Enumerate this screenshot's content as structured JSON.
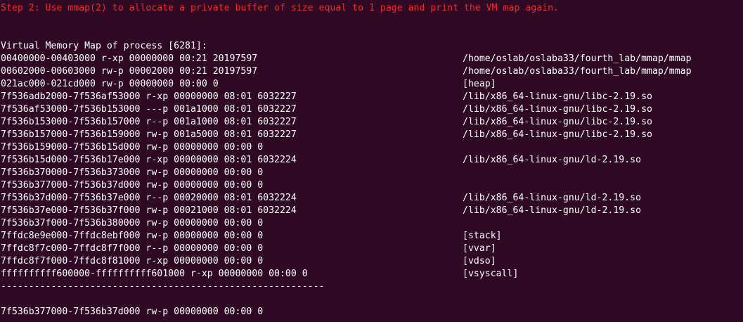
{
  "terminal": {
    "step_message": "Step 2: Use mmap(2) to allocate a private buffer of size equal to 1 page and print the VM map again.",
    "map_header": "Virtual Memory Map of process [6281]:",
    "map_rows": [
      {
        "entry": "00400000-00403000 r-xp 00000000 00:21 20197597",
        "path": "/home/oslab/oslaba33/fourth_lab/mmap/mmap"
      },
      {
        "entry": "00602000-00603000 rw-p 00002000 00:21 20197597",
        "path": "/home/oslab/oslaba33/fourth_lab/mmap/mmap"
      },
      {
        "entry": "021ac000-021cd000 rw-p 00000000 00:00 0",
        "path": "[heap]"
      },
      {
        "entry": "7f536adb2000-7f536af53000 r-xp 00000000 08:01 6032227",
        "path": "/lib/x86_64-linux-gnu/libc-2.19.so"
      },
      {
        "entry": "7f536af53000-7f536b153000 ---p 001a1000 08:01 6032227",
        "path": "/lib/x86_64-linux-gnu/libc-2.19.so"
      },
      {
        "entry": "7f536b153000-7f536b157000 r--p 001a1000 08:01 6032227",
        "path": "/lib/x86_64-linux-gnu/libc-2.19.so"
      },
      {
        "entry": "7f536b157000-7f536b159000 rw-p 001a5000 08:01 6032227",
        "path": "/lib/x86_64-linux-gnu/libc-2.19.so"
      },
      {
        "entry": "7f536b159000-7f536b15d000 rw-p 00000000 00:00 0",
        "path": ""
      },
      {
        "entry": "7f536b15d000-7f536b17e000 r-xp 00000000 08:01 6032224",
        "path": "/lib/x86_64-linux-gnu/ld-2.19.so"
      },
      {
        "entry": "7f536b370000-7f536b373000 rw-p 00000000 00:00 0",
        "path": ""
      },
      {
        "entry": "7f536b377000-7f536b37d000 rw-p 00000000 00:00 0",
        "path": ""
      },
      {
        "entry": "7f536b37d000-7f536b37e000 r--p 00020000 08:01 6032224",
        "path": "/lib/x86_64-linux-gnu/ld-2.19.so"
      },
      {
        "entry": "7f536b37e000-7f536b37f000 rw-p 00021000 08:01 6032224",
        "path": "/lib/x86_64-linux-gnu/ld-2.19.so"
      },
      {
        "entry": "7f536b37f000-7f536b380000 rw-p 00000000 00:00 0",
        "path": ""
      },
      {
        "entry": "7ffdc8e9e000-7ffdc8ebf000 rw-p 00000000 00:00 0",
        "path": "[stack]"
      },
      {
        "entry": "7ffdc8f7c000-7ffdc8f7f000 r--p 00000000 00:00 0",
        "path": "[vvar]"
      },
      {
        "entry": "7ffdc8f7f000-7ffdc8f81000 r-xp 00000000 00:00 0",
        "path": "[vdso]"
      },
      {
        "entry": "ffffffffff600000-ffffffffff601000 r-xp 00000000 00:00 0",
        "path": "[vsyscall]"
      }
    ],
    "separator": "----------------------------------------------------------",
    "buffer_row": "7f536b377000-7f536b37d000 rw-p 00000000 00:00 0",
    "colors": {
      "background": "#300a24",
      "text": "#ffffff",
      "step_text": "#ef2929"
    }
  }
}
